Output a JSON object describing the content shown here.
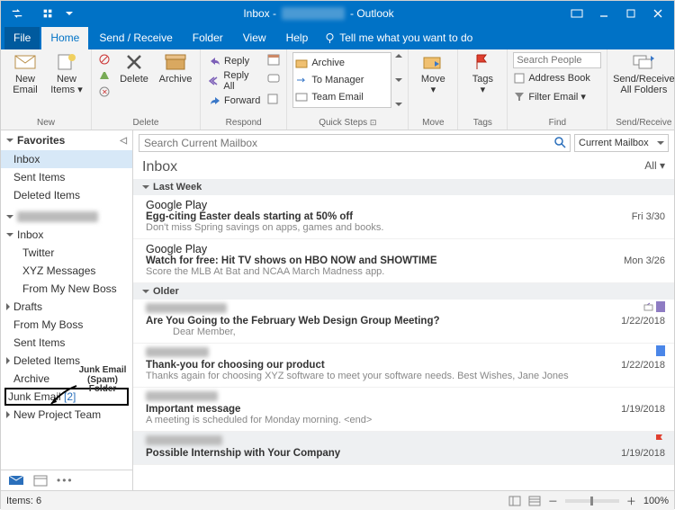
{
  "titlebar": {
    "title_prefix": "Inbox -",
    "title_suffix": "- Outlook"
  },
  "menu": {
    "file": "File",
    "home": "Home",
    "sendreceive": "Send / Receive",
    "folder": "Folder",
    "view": "View",
    "help": "Help",
    "tellme": "Tell me what you want to do"
  },
  "ribbon": {
    "new_email": "New\nEmail",
    "new_items": "New\nItems ▾",
    "delete": "Delete",
    "archive": "Archive",
    "reply": "Reply",
    "reply_all": "Reply All",
    "forward": "Forward",
    "qs_archive": "Archive",
    "qs_manager": "To Manager",
    "qs_team": "Team Email",
    "move": "Move\n▾",
    "tags": "Tags\n▾",
    "search_people_ph": "Search People",
    "address_book": "Address Book",
    "filter_email": "Filter Email ▾",
    "sendrcv": "Send/Receive\nAll Folders",
    "grp_new": "New",
    "grp_delete": "Delete",
    "grp_respond": "Respond",
    "grp_qs": "Quick Steps",
    "grp_move": "Move",
    "grp_tags": "Tags",
    "grp_find": "Find",
    "grp_sr": "Send/Receive"
  },
  "nav": {
    "favorites": "Favorites",
    "fav_items": [
      "Inbox",
      "Sent Items",
      "Deleted Items"
    ],
    "inbox": "Inbox",
    "inbox_sub": [
      "Twitter",
      "XYZ Messages",
      "From My New Boss"
    ],
    "drafts": "Drafts",
    "from_boss": "From My Boss",
    "sent": "Sent Items",
    "deleted": "Deleted Items",
    "archive": "Archive",
    "junk_label": "Junk Email",
    "junk_count": "[2]",
    "new_project": "New Project Team"
  },
  "annotation": {
    "label": "Junk Email\n(Spam) Folder"
  },
  "search": {
    "placeholder": "Search Current Mailbox",
    "scope": "Current Mailbox"
  },
  "list": {
    "title": "Inbox",
    "filter": "All ▾",
    "grp_lastweek": "Last Week",
    "grp_older": "Older",
    "msgs": [
      {
        "sender": "Google Play",
        "subject": "Egg-citing Easter deals starting at 50% off",
        "preview": "Don't miss Spring savings on apps, games and books.",
        "date": "Fri 3/30"
      },
      {
        "sender": "Google Play",
        "subject": "Watch for free: Hit TV shows on HBO NOW and SHOWTIME",
        "preview": "Score the MLB At Bat and NCAA March Madness app.",
        "date": "Mon 3/26"
      },
      {
        "sender": "(redacted)",
        "subject": "Are You Going to the February Web Design Group Meeting?",
        "preview": "Dear Member,",
        "date": "1/22/2018",
        "reply": true,
        "cat": "#8e7cc3"
      },
      {
        "sender": "(redacted)",
        "subject": "Thank-you for choosing our product",
        "preview": "Thanks again for choosing XYZ software to meet your software needs.  Best Wishes,  Jane Jones",
        "date": "1/22/2018",
        "cat": "#4a86e8"
      },
      {
        "sender": "(redacted)",
        "subject": "Important message",
        "preview": "A meeting is scheduled for Monday morning. <end>",
        "date": "1/19/2018"
      },
      {
        "sender": "(redacted)",
        "subject": "Possible Internship with Your Company",
        "preview": "",
        "date": "1/19/2018",
        "flag": true
      }
    ]
  },
  "status": {
    "items": "Items: 6",
    "zoom": "100%"
  }
}
